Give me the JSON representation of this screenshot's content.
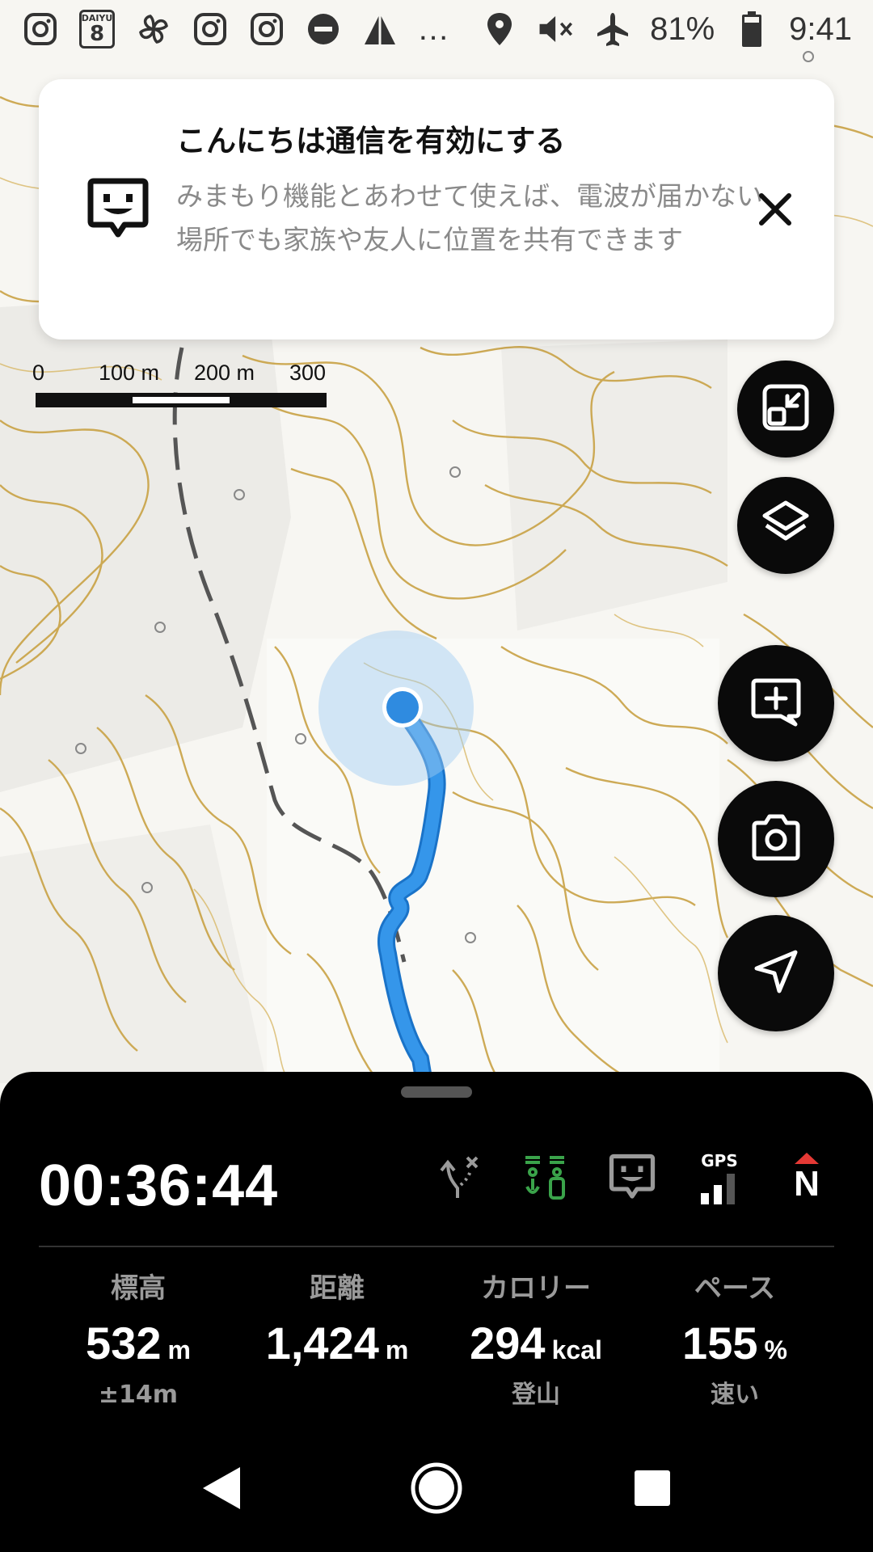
{
  "status_bar": {
    "battery": "81%",
    "time": "9:41",
    "daiyu_text": "DAIYU",
    "daiyu_number": "8",
    "more": "…",
    "icons": [
      "instagram-icon",
      "daiyu8-icon",
      "pinwheel-icon",
      "instagram-icon",
      "instagram-icon",
      "do-not-disturb-icon",
      "triangle-app-icon",
      "location-icon",
      "mute-icon",
      "airplane-icon",
      "battery-icon"
    ]
  },
  "notification": {
    "title": "こんにちは通信を有効にする",
    "body": "みまもり機能とあわせて使えば、電波が届かない場所でも家族や友人に位置を共有できます",
    "icon": "message-face-icon",
    "close_icon": "close-icon"
  },
  "scale": {
    "labels": [
      "0",
      "100 m",
      "200 m",
      "300 m"
    ]
  },
  "fabs": [
    "fullscreen-exit-icon",
    "layers-icon",
    "add-memo-icon",
    "camera-icon",
    "navigation-icon"
  ],
  "tracker": {
    "elapsed": "00:36:44",
    "icons": [
      "route-off-icon",
      "mimamori-icon",
      "message-face-icon",
      "gps-signal-icon",
      "compass-north-icon"
    ],
    "gps_label": "GPS",
    "compass_label": "N",
    "stats": [
      {
        "label": "標高",
        "value": "532",
        "unit": "m",
        "sub": "±14m"
      },
      {
        "label": "距離",
        "value": "1,424",
        "unit": "m",
        "sub": ""
      },
      {
        "label": "カロリー",
        "value": "294",
        "unit": "kcal",
        "sub": "登山"
      },
      {
        "label": "ペース",
        "value": "155",
        "unit": "%",
        "sub": "速い"
      }
    ]
  },
  "colors": {
    "track": "#2f8be0",
    "location": "#2f8be0",
    "contour": "#c9a245",
    "active_icon": "#3aa34a",
    "compass_red": "#e53935"
  },
  "navbar": [
    "back-icon",
    "home-icon",
    "recents-icon"
  ]
}
